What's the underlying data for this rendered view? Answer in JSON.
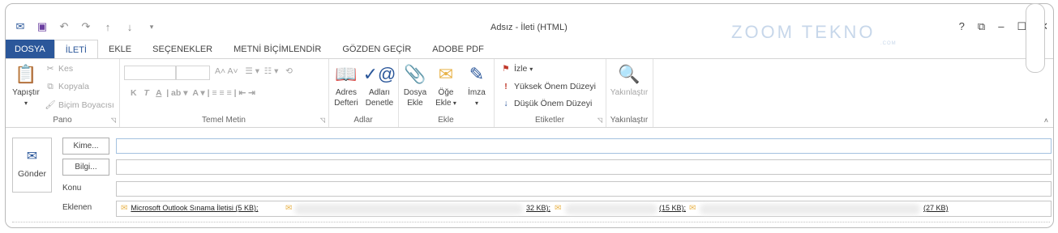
{
  "window": {
    "title": "Adsız - İleti (HTML)",
    "help": "?",
    "restore_ribbon": "⧉",
    "minimize": "–",
    "maximize": "☐",
    "close": "✕"
  },
  "quick_access": {
    "icons": [
      "mail-icon",
      "save-icon",
      "undo-icon",
      "redo-icon",
      "up-icon",
      "down-icon",
      "customize-icon"
    ]
  },
  "watermark": {
    "text": "ZOOM TEKNO",
    "sub": ".COM"
  },
  "tabs": [
    "DOSYA",
    "İLETİ",
    "EKLE",
    "SEÇENEKLER",
    "METNİ BİÇİMLENDİR",
    "GÖZDEN GEÇİR",
    "ADOBE PDF"
  ],
  "ribbon": {
    "pano": {
      "label": "Pano",
      "paste": "Yapıştır",
      "cut": "Kes",
      "copy": "Kopyala",
      "format_painter": "Biçim Boyacısı"
    },
    "temel_metin": {
      "label": "Temel Metin",
      "bold": "K",
      "italic": "T",
      "underline": "A"
    },
    "adlar": {
      "label": "Adlar",
      "address_book_l1": "Adres",
      "address_book_l2": "Defteri",
      "check_names_l1": "Adları",
      "check_names_l2": "Denetle"
    },
    "ekle": {
      "label": "Ekle",
      "attach_file_l1": "Dosya",
      "attach_file_l2": "Ekle",
      "attach_item_l1": "Öğe",
      "attach_item_l2": "Ekle",
      "signature": "İmza"
    },
    "etiketler": {
      "label": "Etiketler",
      "follow_up": "İzle",
      "high_importance": "Yüksek Önem Düzeyi",
      "low_importance": "Düşük Önem Düzeyi"
    },
    "yakinlastir": {
      "label": "Yakınlaştır",
      "zoom": "Yakınlaştır"
    }
  },
  "compose": {
    "send": "Gönder",
    "to": "Kime...",
    "cc": "Bilgi...",
    "subject": "Konu",
    "attached": "Eklenen",
    "attachments": [
      "Microsoft Outlook Sınama İletisi (5 KB);",
      "32 KB);",
      "(15 KB);",
      "(27 KB)"
    ]
  }
}
